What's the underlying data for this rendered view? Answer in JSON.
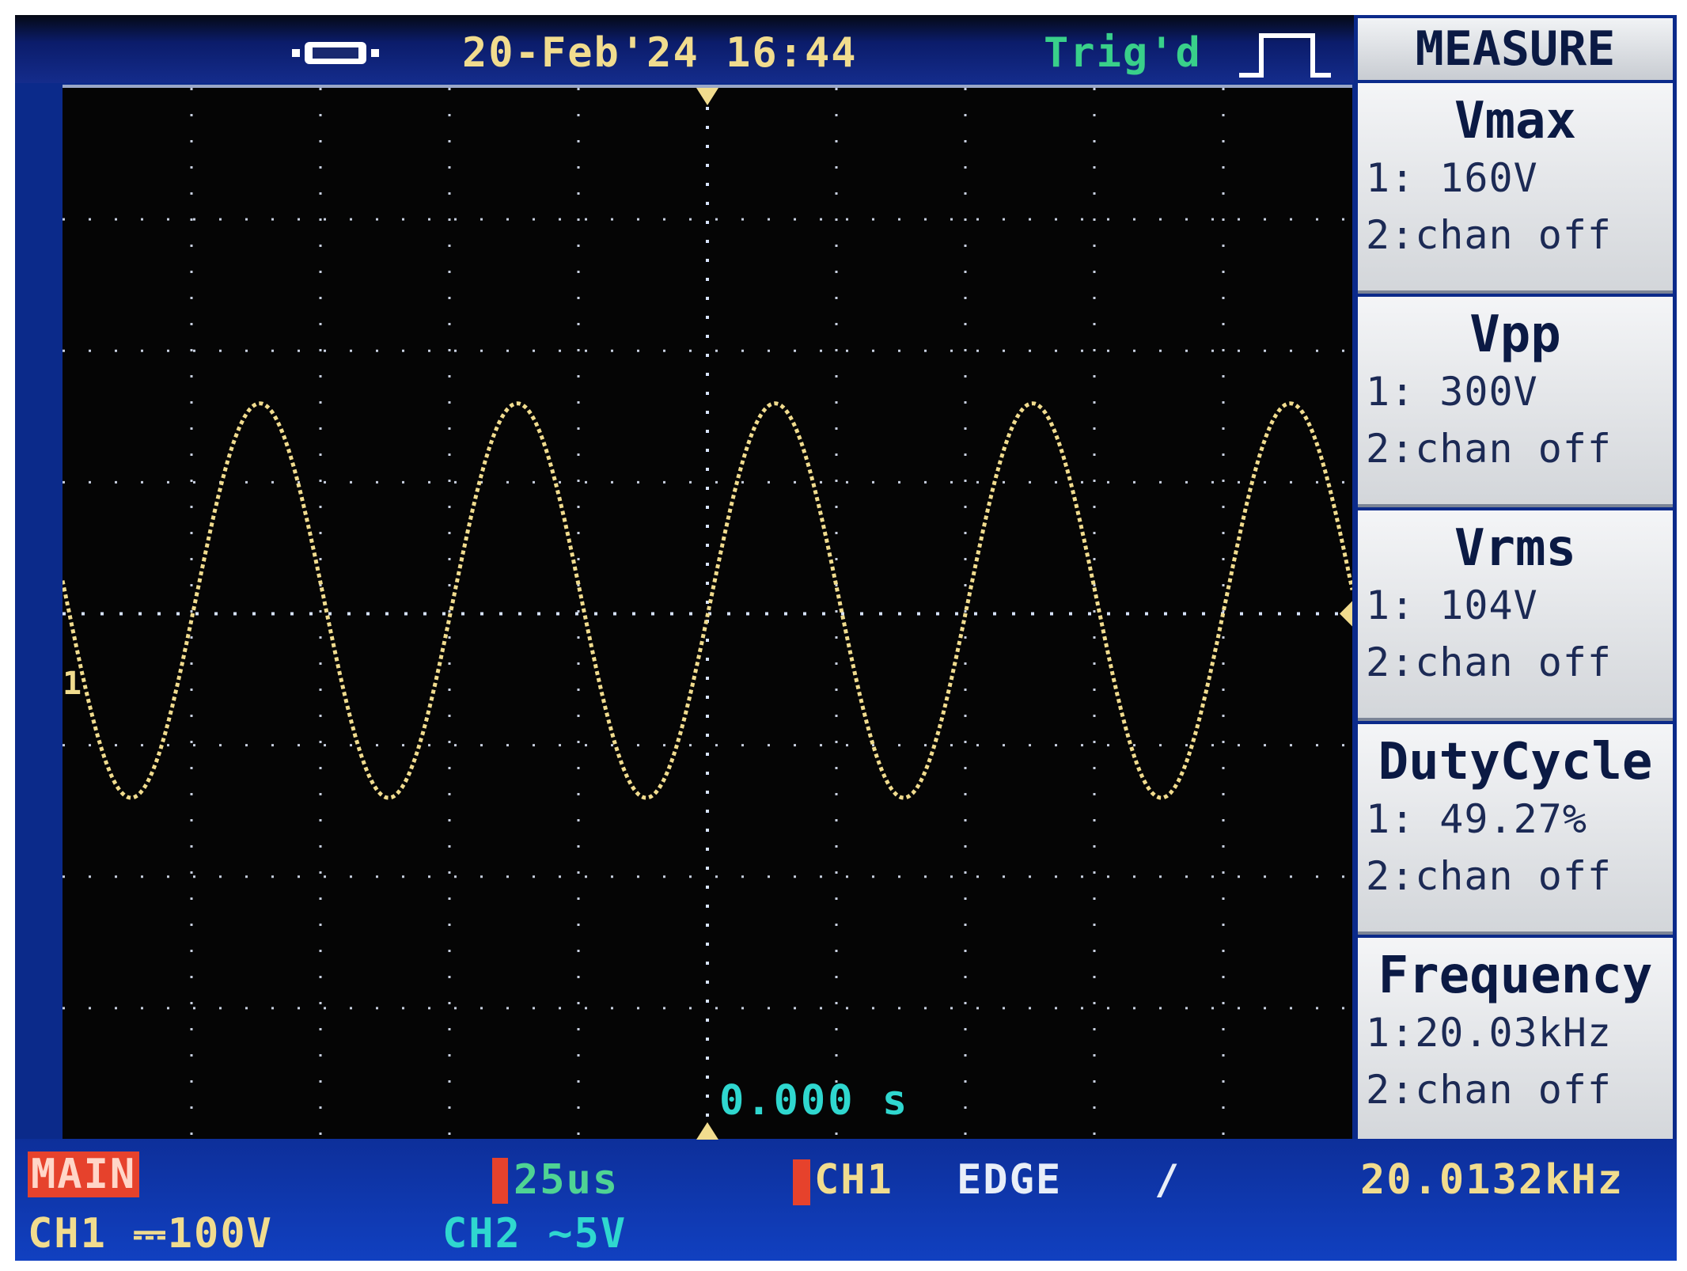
{
  "top_bar": {
    "usb_icon": "usb-connector-icon",
    "datetime": "20-Feb'24 16:44",
    "trigger_status": "Trig'd",
    "trigger_edge_icon": "rising-pulse-icon"
  },
  "display": {
    "ch1_marker": "1",
    "time_offset": "0.000 s"
  },
  "measure_panel": {
    "title": "MEASURE",
    "items": [
      {
        "name": "Vmax",
        "ch1": "1: 160V",
        "ch2": "2:chan off"
      },
      {
        "name": "Vpp",
        "ch1": "1: 300V",
        "ch2": "2:chan off"
      },
      {
        "name": "Vrms",
        "ch1": "1: 104V",
        "ch2": "2:chan off"
      },
      {
        "name": "DutyCycle",
        "ch1": "1: 49.27%",
        "ch2": "2:chan off"
      },
      {
        "name": "Frequency",
        "ch1": "1:20.03kHz",
        "ch2": "2:chan off"
      }
    ]
  },
  "bottom_bar": {
    "mode": "MAIN",
    "timebase": "25us",
    "trigger_source": "CH1",
    "trigger_type": "EDGE",
    "trigger_slope": "/",
    "frequency": "20.0132kHz",
    "ch1_scale": "CH1 ⎓100V",
    "ch2_scale": "CH2 ∼5V"
  },
  "colors": {
    "ch1": "#f1dc8e",
    "ch2": "#2fd7cf",
    "trig": "#39d08a"
  },
  "chart_data": {
    "type": "line",
    "title": "CH1 sine waveform",
    "x_unit": "us",
    "x_per_div": 25,
    "x_divisions": 10,
    "xlim": [
      -125,
      125
    ],
    "y_unit": "V",
    "y_per_div": 100,
    "y_divisions": 8,
    "ylim": [
      -400,
      400
    ],
    "series": [
      {
        "name": "CH1",
        "frequency_hz": 20030,
        "vmax": 160,
        "vmin": -140,
        "offset_v": 10,
        "first_peak_time_us": -86.75
      }
    ]
  }
}
